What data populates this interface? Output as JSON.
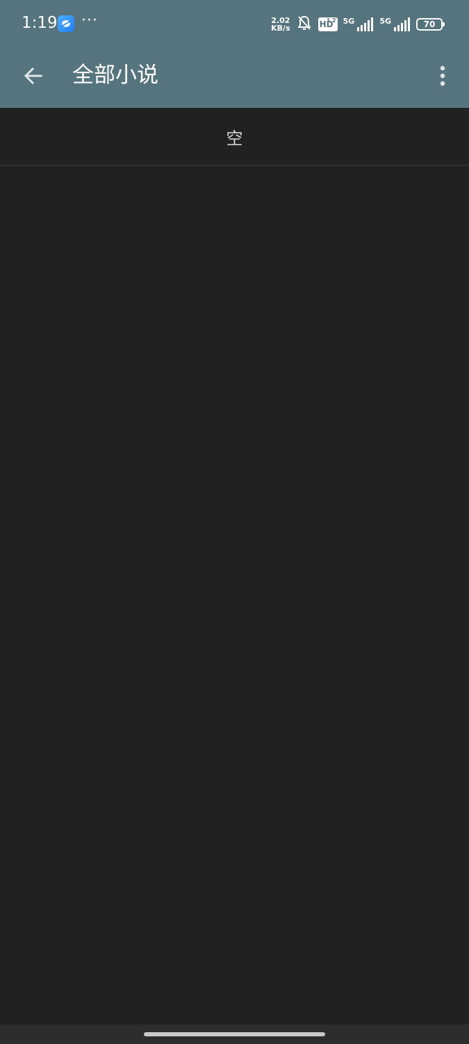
{
  "status_bar": {
    "time": "1:19",
    "more_indicator": "···",
    "net_speed_value": "2.02",
    "net_speed_unit": "KB/s",
    "hd_label": "HD",
    "hd_sub": "1 2",
    "signal_1_label": "5G",
    "signal_2_label": "5G",
    "battery_level": "70",
    "icons": [
      "app-notification-icon",
      "silent-bell-icon",
      "hd-voice-icon",
      "signal-icon",
      "battery-icon"
    ]
  },
  "app_bar": {
    "title": "全部小说",
    "back_icon": "arrow-left-icon",
    "overflow_icon": "more-vert-icon"
  },
  "list": {
    "empty_text": "空"
  },
  "colors": {
    "app_bar": "#56747e",
    "background": "#212121",
    "nav_area": "#2d2d2d"
  }
}
